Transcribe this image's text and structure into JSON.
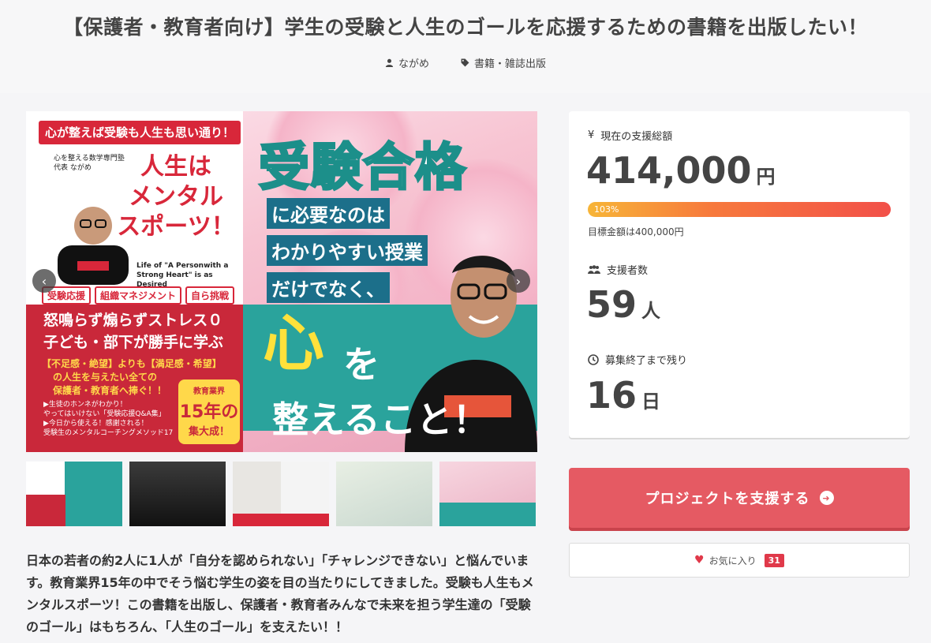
{
  "project": {
    "title": "【保護者・教育者向け】学生の受験と人生のゴールを応援するための書籍を出版したい！",
    "author": "ながめ",
    "category": "書籍・雑誌出版"
  },
  "hero": {
    "card_top": "心が整えば受験も人生も思い通り！",
    "card_sub1": "心を整える数学専門塾",
    "card_sub2": "代表 ながめ",
    "card_big1": "人生は",
    "card_big2": "メンタル",
    "card_big3": "スポーツ！",
    "card_eng": "Life of \"A Personwith a Strong Heart\" is as Desired",
    "tag1": "受験応援",
    "tag2": "組織マネジメント",
    "tag3": "自ら挑戦",
    "red_line1": "怒鳴らず煽らずストレス０",
    "red_line2": "子ども・部下が勝手に学ぶ",
    "yellow1": "【不足感・絶望】よりも【満足感・希望】",
    "yellow2": "の人生を与えたい全ての",
    "yellow3": "保護者・教育者へ捧ぐ！！",
    "small1": "▶生徒のホンネがわかり！",
    "small2": "やってはいけない「受験応援Q&A集」",
    "small3": "▶今日から使える！感謝される！",
    "small4": "受験生のメンタルコーチングメソッド17",
    "badge1": "教育業界",
    "badge2": "15年の",
    "badge3": "集大成！",
    "big_title": "受験合格",
    "line1": "に必要なのは",
    "line2": "わかりやすい授業",
    "line3": "だけでなく、",
    "kokoro": "心",
    "wo": "を",
    "totono": "整えること！"
  },
  "nav": {
    "prev": "‹",
    "next": "›"
  },
  "description": "日本の若者の約2人に1人が「自分を認められない」「チャレンジできない」と悩んでいます。教育業界15年の中でそう悩む学生の姿を目の当たりにしてきました。受験も人生もメンタルスポーツ！この書籍を出版し、保護者・教育者みんなで未来を担う学生達の「受験のゴール」はもちろん、「人生のゴール」を支えたい！！",
  "stats": {
    "total_label": "現在の支援総額",
    "total_value": "414,000",
    "total_unit": "円",
    "progress_percent": 103,
    "progress_label": "103%",
    "goal_text": "目標金額は400,000円",
    "supporters_label": "支援者数",
    "supporters_value": "59",
    "supporters_unit": "人",
    "remaining_label": "募集終了まで残り",
    "remaining_value": "16",
    "remaining_unit": "日",
    "yen_symbol": "¥"
  },
  "cta": {
    "label": "プロジェクトを支援する"
  },
  "favorite": {
    "label": "お気に入り",
    "count": "31"
  },
  "colors": {
    "accent": "#e55a63",
    "teal": "#2aa39c",
    "red": "#d8273a"
  }
}
